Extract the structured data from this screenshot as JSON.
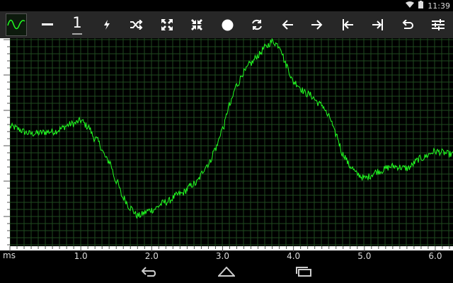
{
  "status_bar": {
    "time": "11:39",
    "icons": [
      "wifi-icon",
      "battery-icon"
    ]
  },
  "toolbar": {
    "channel_number": "1",
    "buttons": [
      "minus-icon",
      "channel-number",
      "trigger-bolt-icon",
      "shuffle-icon",
      "expand-icon",
      "collapse-icon",
      "record-icon",
      "refresh-icon",
      "arrow-left-icon",
      "arrow-right-icon",
      "skip-to-start-icon",
      "skip-to-end-icon",
      "undo-icon",
      "settings-sliders-icon"
    ]
  },
  "scope": {
    "trace_color": "#22ff22",
    "grid_color": "#1f4a1f",
    "background": "#000000"
  },
  "chart_data": {
    "type": "line",
    "xlabel": "ms",
    "x_ticks": [
      "1.0",
      "2.0",
      "3.0",
      "4.0",
      "5.0",
      "6.0"
    ],
    "xlim": [
      0.0,
      6.25
    ],
    "series": [
      {
        "x": [
          0.0,
          0.3,
          0.6,
          0.9,
          1.0,
          1.1,
          1.2,
          1.4,
          1.5,
          1.6,
          1.7,
          1.8,
          2.0,
          2.2,
          2.4,
          2.6,
          2.8,
          2.9,
          3.0,
          3.1,
          3.2,
          3.3,
          3.4,
          3.5,
          3.6,
          3.7,
          3.8,
          3.9,
          4.0,
          4.2,
          4.4,
          4.5,
          4.6,
          4.7,
          4.8,
          4.9,
          5.0,
          5.2,
          5.4,
          5.6,
          5.8,
          6.0,
          6.25
        ],
        "y": [
          0.0,
          -0.07,
          -0.05,
          0.03,
          0.06,
          0.0,
          -0.12,
          -0.35,
          -0.55,
          -0.72,
          -0.82,
          -0.9,
          -0.84,
          -0.76,
          -0.68,
          -0.58,
          -0.38,
          -0.22,
          -0.02,
          0.22,
          0.42,
          0.55,
          0.64,
          0.72,
          0.8,
          0.86,
          0.82,
          0.62,
          0.45,
          0.33,
          0.22,
          0.1,
          -0.08,
          -0.28,
          -0.4,
          -0.48,
          -0.52,
          -0.45,
          -0.4,
          -0.42,
          -0.32,
          -0.25,
          -0.28
        ]
      }
    ],
    "grid": true
  },
  "nav": {
    "buttons": [
      "back-icon",
      "home-icon",
      "recents-icon"
    ]
  }
}
